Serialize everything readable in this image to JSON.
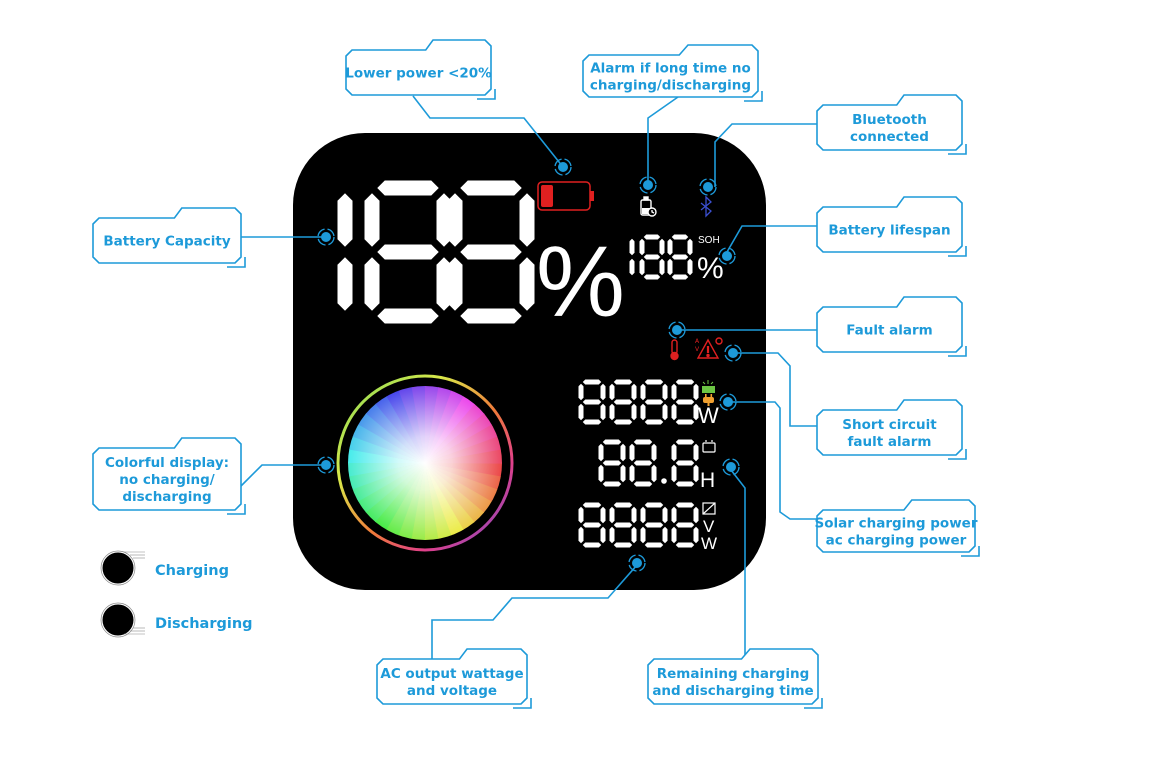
{
  "colors": {
    "accent": "#1d9ad9",
    "panel": "#000000",
    "segment": "#ffffff",
    "alert_red": "#e02020",
    "bluetooth_blue": "#3b4fd0",
    "solar_green": "#6cc644",
    "plug_orange": "#f0a030"
  },
  "display": {
    "battery_capacity_digits": "188",
    "battery_capacity_unit": "%",
    "soh_label": "SOH",
    "soh_digits": "188",
    "soh_unit": "%",
    "input_power_digits": "8888",
    "input_power_unit": "W",
    "time_digits": "88.8",
    "time_unit": "H",
    "output_digits": "8888",
    "output_unit_v": "V",
    "output_unit_w": "W"
  },
  "icons": {
    "low_battery": "battery-low-icon",
    "idle_alarm": "battery-clock-icon",
    "bluetooth": "bluetooth-icon",
    "temperature": "thermometer-icon",
    "fault": "warning-triangle-icon",
    "solar": "solar-panel-icon",
    "plug": "plug-icon",
    "battery_time": "battery-outline-icon",
    "inverter": "inverter-icon"
  },
  "callouts": {
    "lower_power": [
      "Lower power <20%"
    ],
    "idle_alarm": [
      "Alarm if long time no",
      "charging/discharging"
    ],
    "bluetooth": [
      "Bluetooth",
      "connected"
    ],
    "battery_capacity": [
      "Battery Capacity"
    ],
    "battery_lifespan": [
      "Battery lifespan"
    ],
    "fault_alarm": [
      "Fault alarm"
    ],
    "short_circuit": [
      "Short circuit",
      "fault alarm"
    ],
    "colorful_display": [
      "Colorful display:",
      "no charging/",
      "discharging"
    ],
    "solar_ac": [
      "Solar charging power",
      "ac charging power"
    ],
    "ac_output": [
      "AC output wattage",
      "and voltage"
    ],
    "remaining_time": [
      "Remaining charging",
      "and discharging time"
    ]
  },
  "legend": {
    "charging": "Charging",
    "discharging": "Discharging"
  }
}
